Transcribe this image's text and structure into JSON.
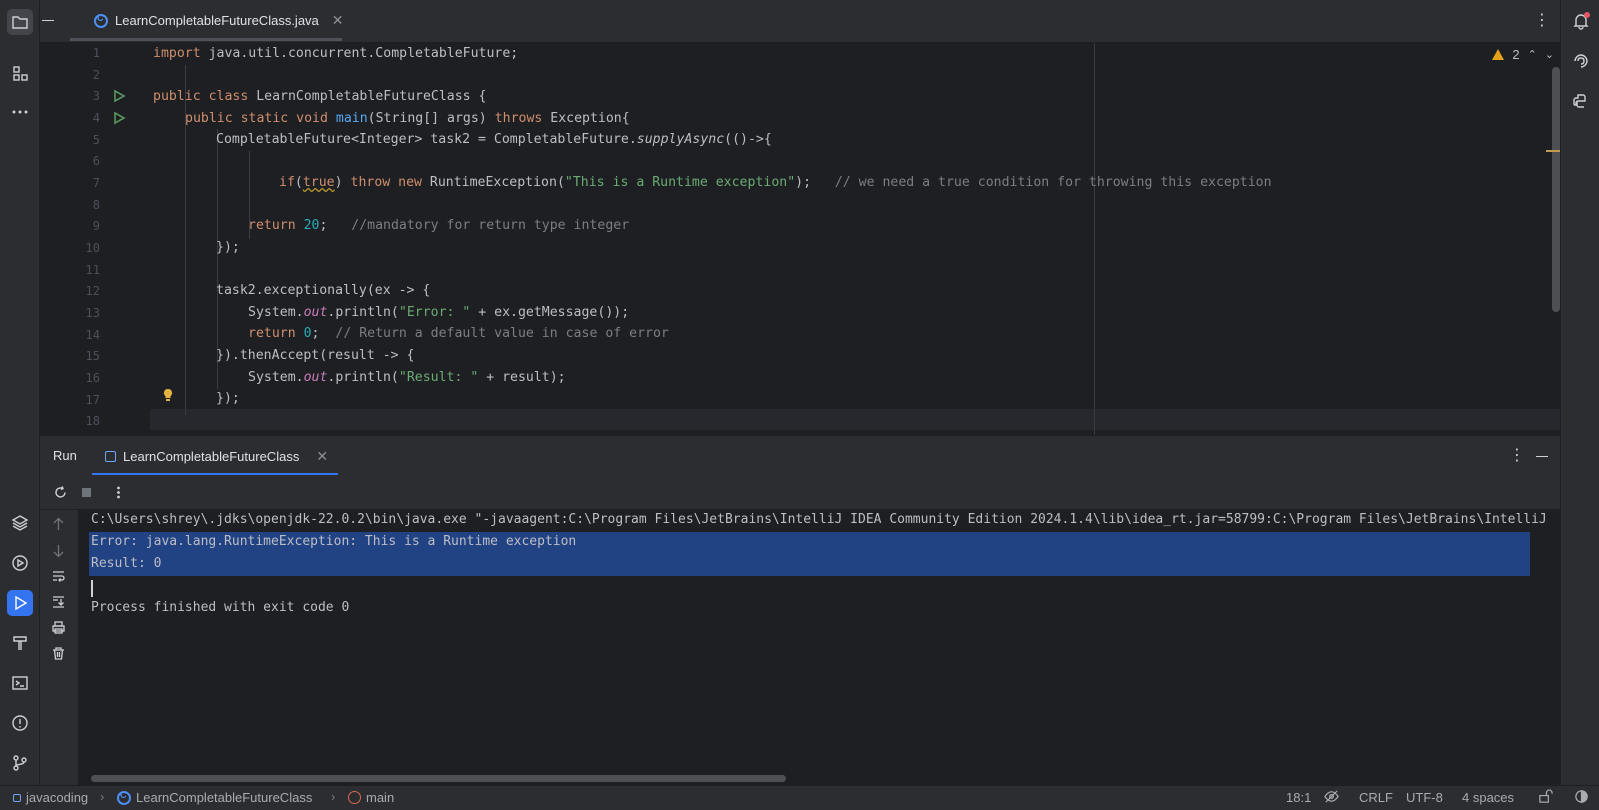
{
  "editor": {
    "tab": {
      "filename": "LearnCompletableFutureClass.java"
    },
    "inspection": {
      "warning_count": "2"
    },
    "line_numbers": [
      "1",
      "2",
      "3",
      "4",
      "5",
      "6",
      "7",
      "8",
      "9",
      "10",
      "11",
      "12",
      "13",
      "14",
      "15",
      "16",
      "17",
      "18"
    ],
    "code": {
      "l1_kw": "import",
      "l1_rest": " java.util.concurrent.CompletableFuture;",
      "l3_kw": "public class",
      "l3_rest": " LearnCompletableFutureClass {",
      "l4_kw1": "public static void",
      "l4_fn": "main",
      "l4_mid": "(String[] args) ",
      "l4_kw2": "throws",
      "l4_rest": " Exception{",
      "l5_a": "CompletableFuture<Integer> task2 = CompletableFuture.",
      "l5_it": "supplyAsync",
      "l5_b": "(()->{",
      "l7_kw1": "if",
      "l7_p1": "(",
      "l7_true": "true",
      "l7_p2": ") ",
      "l7_kw2": "throw new",
      "l7_cls": " RuntimeException(",
      "l7_str": "\"This is a Runtime exception\"",
      "l7_end": ");   ",
      "l7_cmt": "// we need a true condition for throwing this exception",
      "l9_kw": "return",
      "l9_num": "20",
      "l9_semi": ";   ",
      "l9_cmt": "//mandatory for return type integer",
      "l10": "});",
      "l12": "task2.exceptionally(ex -> {",
      "l13_a": "System.",
      "l13_out": "out",
      "l13_b": ".println(",
      "l13_str": "\"Error: \"",
      "l13_c": " + ex.getMessage());",
      "l14_kw": "return",
      "l14_num": "0",
      "l14_semi": ";  ",
      "l14_cmt": "// Return a default value in case of error",
      "l15": "}).thenAccept(result -> {",
      "l16_a": "System.",
      "l16_out": "out",
      "l16_b": ".println(",
      "l16_str": "\"Result: \"",
      "l16_c": " + result);",
      "l17": "});"
    }
  },
  "run_window": {
    "title": "Run",
    "tab_label": "LearnCompletableFutureClass",
    "console_lines": [
      "C:\\Users\\shrey\\.jdks\\openjdk-22.0.2\\bin\\java.exe \"-javaagent:C:\\Program Files\\JetBrains\\IntelliJ IDEA Community Edition 2024.1.4\\lib\\idea_rt.jar=58799:C:\\Program Files\\JetBrains\\IntelliJ",
      "Error: java.lang.RuntimeException: This is a Runtime exception",
      "Result: 0",
      "",
      "Process finished with exit code 0"
    ]
  },
  "status_bar": {
    "project": "javacoding",
    "class": "LearnCompletableFutureClass",
    "method": "main",
    "position": "18:1",
    "line_separator": "CRLF",
    "encoding": "UTF-8",
    "indent": "4 spaces"
  },
  "colors": {
    "accent": "#3574f0",
    "selection": "#214283",
    "keyword": "#cf8e6d",
    "string": "#6aab73",
    "number": "#2aacb8",
    "function": "#56a8f5",
    "warning": "#e3a21a"
  }
}
